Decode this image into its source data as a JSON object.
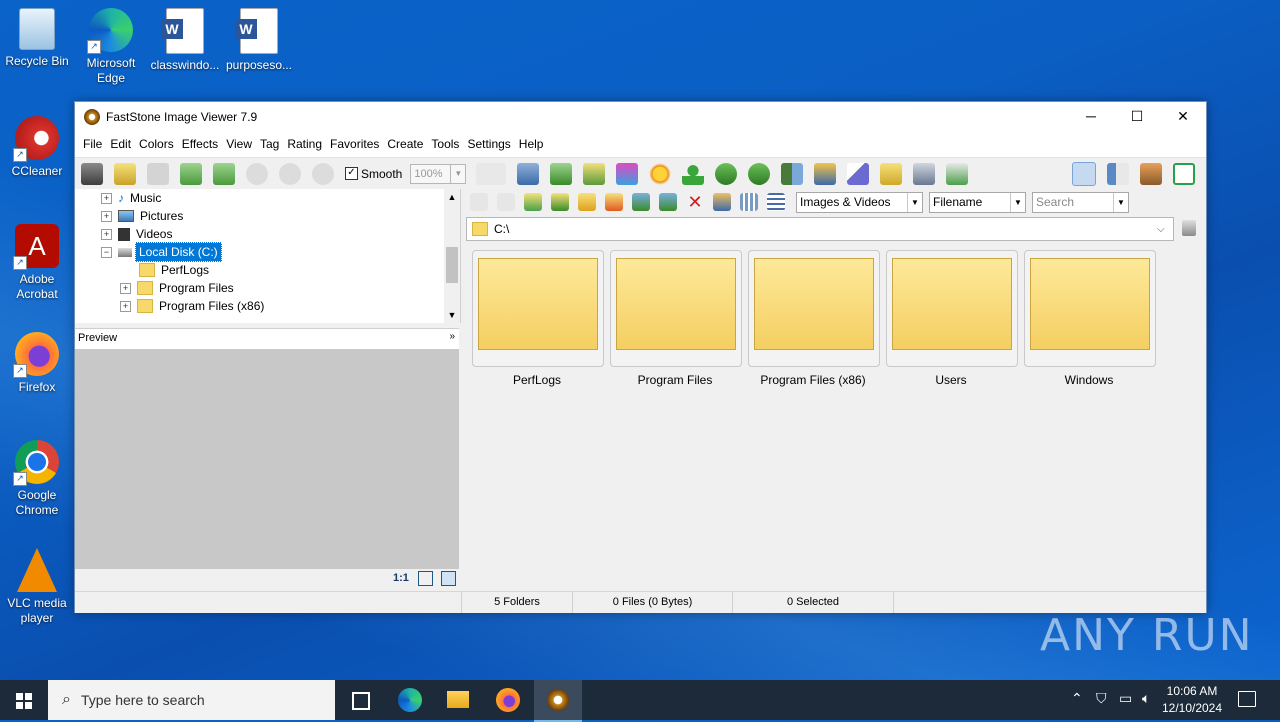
{
  "desktop": {
    "icons": [
      {
        "label": "Recycle Bin",
        "icon": "recycle-bin-icon"
      },
      {
        "label": "Microsoft Edge",
        "icon": "edge-icon"
      },
      {
        "label": "classwindo...",
        "icon": "word-doc-icon"
      },
      {
        "label": "purposeso...",
        "icon": "word-doc-icon"
      },
      {
        "label": "CCleaner",
        "icon": "ccleaner-icon"
      },
      {
        "label": "Adobe Acrobat",
        "icon": "acrobat-icon"
      },
      {
        "label": "Firefox",
        "icon": "firefox-icon"
      },
      {
        "label": "Google Chrome",
        "icon": "chrome-icon"
      },
      {
        "label": "VLC media player",
        "icon": "vlc-icon"
      }
    ],
    "watermark": "ANY RUN"
  },
  "window": {
    "title": "FastStone Image Viewer 7.9",
    "controls": {
      "minimize": "─",
      "maximize": "☐",
      "close": "✕"
    },
    "menu": [
      "File",
      "Edit",
      "Colors",
      "Effects",
      "View",
      "Tag",
      "Rating",
      "Favorites",
      "Create",
      "Tools",
      "Settings",
      "Help"
    ],
    "toolbar": {
      "smooth_label": "Smooth",
      "smooth_checked": "✓",
      "zoom_value": "100%"
    },
    "tree": {
      "items": [
        {
          "label": "Music",
          "expander": "+",
          "selected": false
        },
        {
          "label": "Pictures",
          "expander": "+",
          "selected": false
        },
        {
          "label": "Videos",
          "expander": "+",
          "selected": false
        },
        {
          "label": "Local Disk (C:)",
          "expander": "−",
          "selected": true
        },
        {
          "label": "PerfLogs",
          "expander": "",
          "selected": false
        },
        {
          "label": "Program Files",
          "expander": "+",
          "selected": false
        },
        {
          "label": "Program Files (x86)",
          "expander": "+",
          "selected": false
        }
      ]
    },
    "preview": {
      "header": "Preview",
      "footer_ratio": "1:1"
    },
    "browser": {
      "filter_value": "Images & Videos",
      "sort_value": "Filename",
      "search_placeholder": "Search",
      "path": "C:\\",
      "folders": [
        "PerfLogs",
        "Program Files",
        "Program Files (x86)",
        "Users",
        "Windows"
      ]
    },
    "status": {
      "folders": "5 Folders",
      "files": "0 Files (0 Bytes)",
      "selected": "0 Selected"
    }
  },
  "taskbar": {
    "search_placeholder": "Type here to search",
    "time": "10:06 AM",
    "date": "12/10/2024"
  },
  "colors": {
    "desktop_blue": "#0b5fc4",
    "selection": "#0078d7",
    "folder_yellow": "#f8d978"
  }
}
